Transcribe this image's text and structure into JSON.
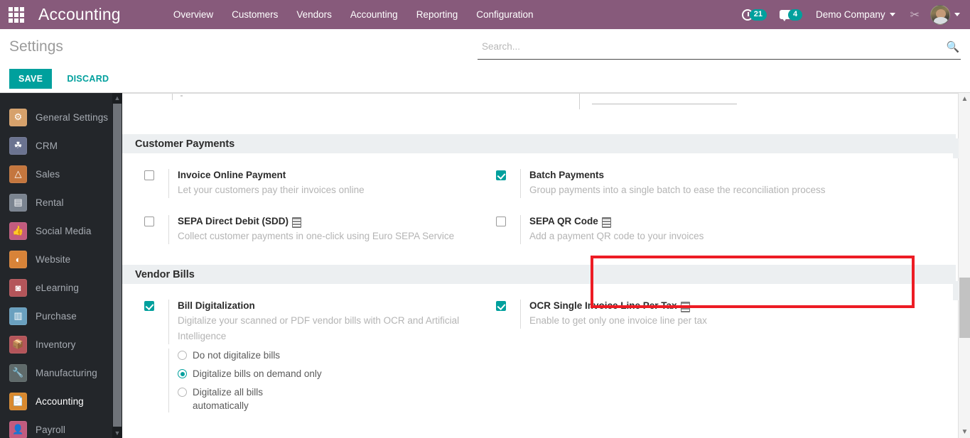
{
  "topbar": {
    "apps_icon": "grid-apps-icon",
    "brand": "Accounting",
    "menu": [
      {
        "label": "Overview"
      },
      {
        "label": "Customers"
      },
      {
        "label": "Vendors"
      },
      {
        "label": "Accounting"
      },
      {
        "label": "Reporting"
      },
      {
        "label": "Configuration"
      }
    ],
    "activity_icon": "clock-icon",
    "activity_count": "21",
    "messages_icon": "chat-icon",
    "messages_count": "4",
    "company": "Demo Company",
    "debug_icon": "tools-icon",
    "avatar_icon": "user-avatar",
    "accent_color": "#875A7B",
    "badge_color": "#00A09D"
  },
  "control_panel": {
    "title": "Settings",
    "save_label": "SAVE",
    "discard_label": "DISCARD",
    "search_placeholder": "Search...",
    "search_value": "",
    "search_icon": "search-icon",
    "primary_color": "#00A09D"
  },
  "sidebar": {
    "items": [
      {
        "label": "General Settings",
        "icon": "gear-icon",
        "glyph": "⚙",
        "bg": "#d6a16b",
        "active": false
      },
      {
        "label": "CRM",
        "icon": "handshake-icon",
        "glyph": "↺",
        "bg": "#6b7390",
        "active": false
      },
      {
        "label": "Sales",
        "icon": "chart-up-icon",
        "glyph": "↗",
        "bg": "#c4763e",
        "active": false
      },
      {
        "label": "Rental",
        "icon": "calendar-icon",
        "glyph": "▤",
        "bg": "#7b8490",
        "active": false
      },
      {
        "label": "Social Media",
        "icon": "thumbs-up-icon",
        "glyph": "☝",
        "bg": "#c25b7e",
        "active": false
      },
      {
        "label": "Website",
        "icon": "globe-icon",
        "glyph": "◔",
        "bg": "#d88338",
        "active": false
      },
      {
        "label": "eLearning",
        "icon": "graduation-icon",
        "glyph": "◩",
        "bg": "#b4555a",
        "active": false
      },
      {
        "label": "Purchase",
        "icon": "card-icon",
        "glyph": "▥",
        "bg": "#6aa0bf",
        "active": false
      },
      {
        "label": "Inventory",
        "icon": "box-icon",
        "glyph": "⬟",
        "bg": "#b4555a",
        "active": false
      },
      {
        "label": "Manufacturing",
        "icon": "wrench-icon",
        "glyph": "⚒",
        "bg": "#5f6a6a",
        "active": false
      },
      {
        "label": "Accounting",
        "icon": "invoice-icon",
        "glyph": "$",
        "bg": "#d8892f",
        "active": true
      },
      {
        "label": "Payroll",
        "icon": "employee-icon",
        "glyph": "☺",
        "bg": "#c25b7e",
        "active": false
      }
    ],
    "scroll_up_icon": "chevron-up-icon",
    "scroll_down_icon": "chevron-down-icon"
  },
  "settings": {
    "sections": [
      {
        "id": "customer-payments",
        "title": "Customer Payments",
        "rows": [
          {
            "left": {
              "name": "invoice-online-payment",
              "title": "Invoice Online Payment",
              "desc": "Let your customers pay their invoices online",
              "checked": false,
              "enterprise": false
            },
            "right": {
              "name": "batch-payments",
              "title": "Batch Payments",
              "desc": "Group payments into a single batch to ease the reconciliation process",
              "checked": true,
              "enterprise": false,
              "highlighted": true
            }
          },
          {
            "left": {
              "name": "sepa-direct-debit",
              "title": "SEPA Direct Debit (SDD)",
              "desc": "Collect customer payments in one-click using Euro SEPA Service",
              "checked": false,
              "enterprise": true
            },
            "right": {
              "name": "sepa-qr-code",
              "title": "SEPA QR Code",
              "desc": "Add a payment QR code to your invoices",
              "checked": false,
              "enterprise": true
            }
          }
        ]
      },
      {
        "id": "vendor-bills",
        "title": "Vendor Bills",
        "rows": [
          {
            "left": {
              "name": "bill-digitalization",
              "title": "Bill Digitalization",
              "desc": "Digitalize your scanned or PDF vendor bills with OCR and Artificial Intelligence",
              "checked": true,
              "enterprise": false
            },
            "right": {
              "name": "ocr-single-invoice-line-per-tax",
              "title": "OCR Single Invoice Line Per Tax",
              "desc": "Enable to get only one invoice line per tax",
              "checked": true,
              "enterprise": true
            }
          }
        ],
        "radio_options": [
          {
            "label": "Do not digitalize bills",
            "second": "",
            "selected": false
          },
          {
            "label": "Digitalize bills on demand only",
            "second": "",
            "selected": true
          },
          {
            "label": "Digitalize all bills",
            "second": "automatically",
            "selected": false
          }
        ]
      }
    ],
    "highlight_color": "#ED1C24"
  }
}
